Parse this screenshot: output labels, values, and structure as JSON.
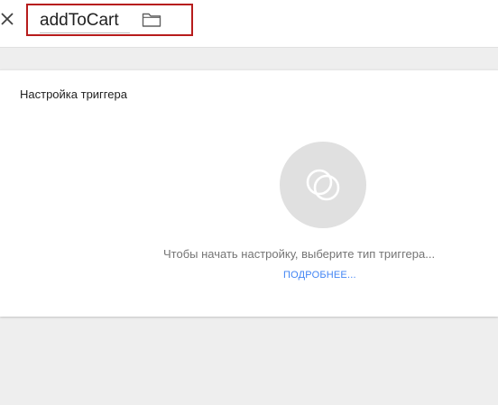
{
  "header": {
    "trigger_name": "addToCart",
    "close_icon": "close-icon",
    "folder_icon": "folder-icon",
    "highlight_color": "#b71c1c"
  },
  "config": {
    "title": "Настройка триггера",
    "trigger_type_icon": "trigger-type-icon",
    "hint": "Чтобы начать настройку, выберите тип триггера...",
    "learn_more": "ПОДРОБНЕЕ...",
    "link_color": "#4285f4"
  }
}
